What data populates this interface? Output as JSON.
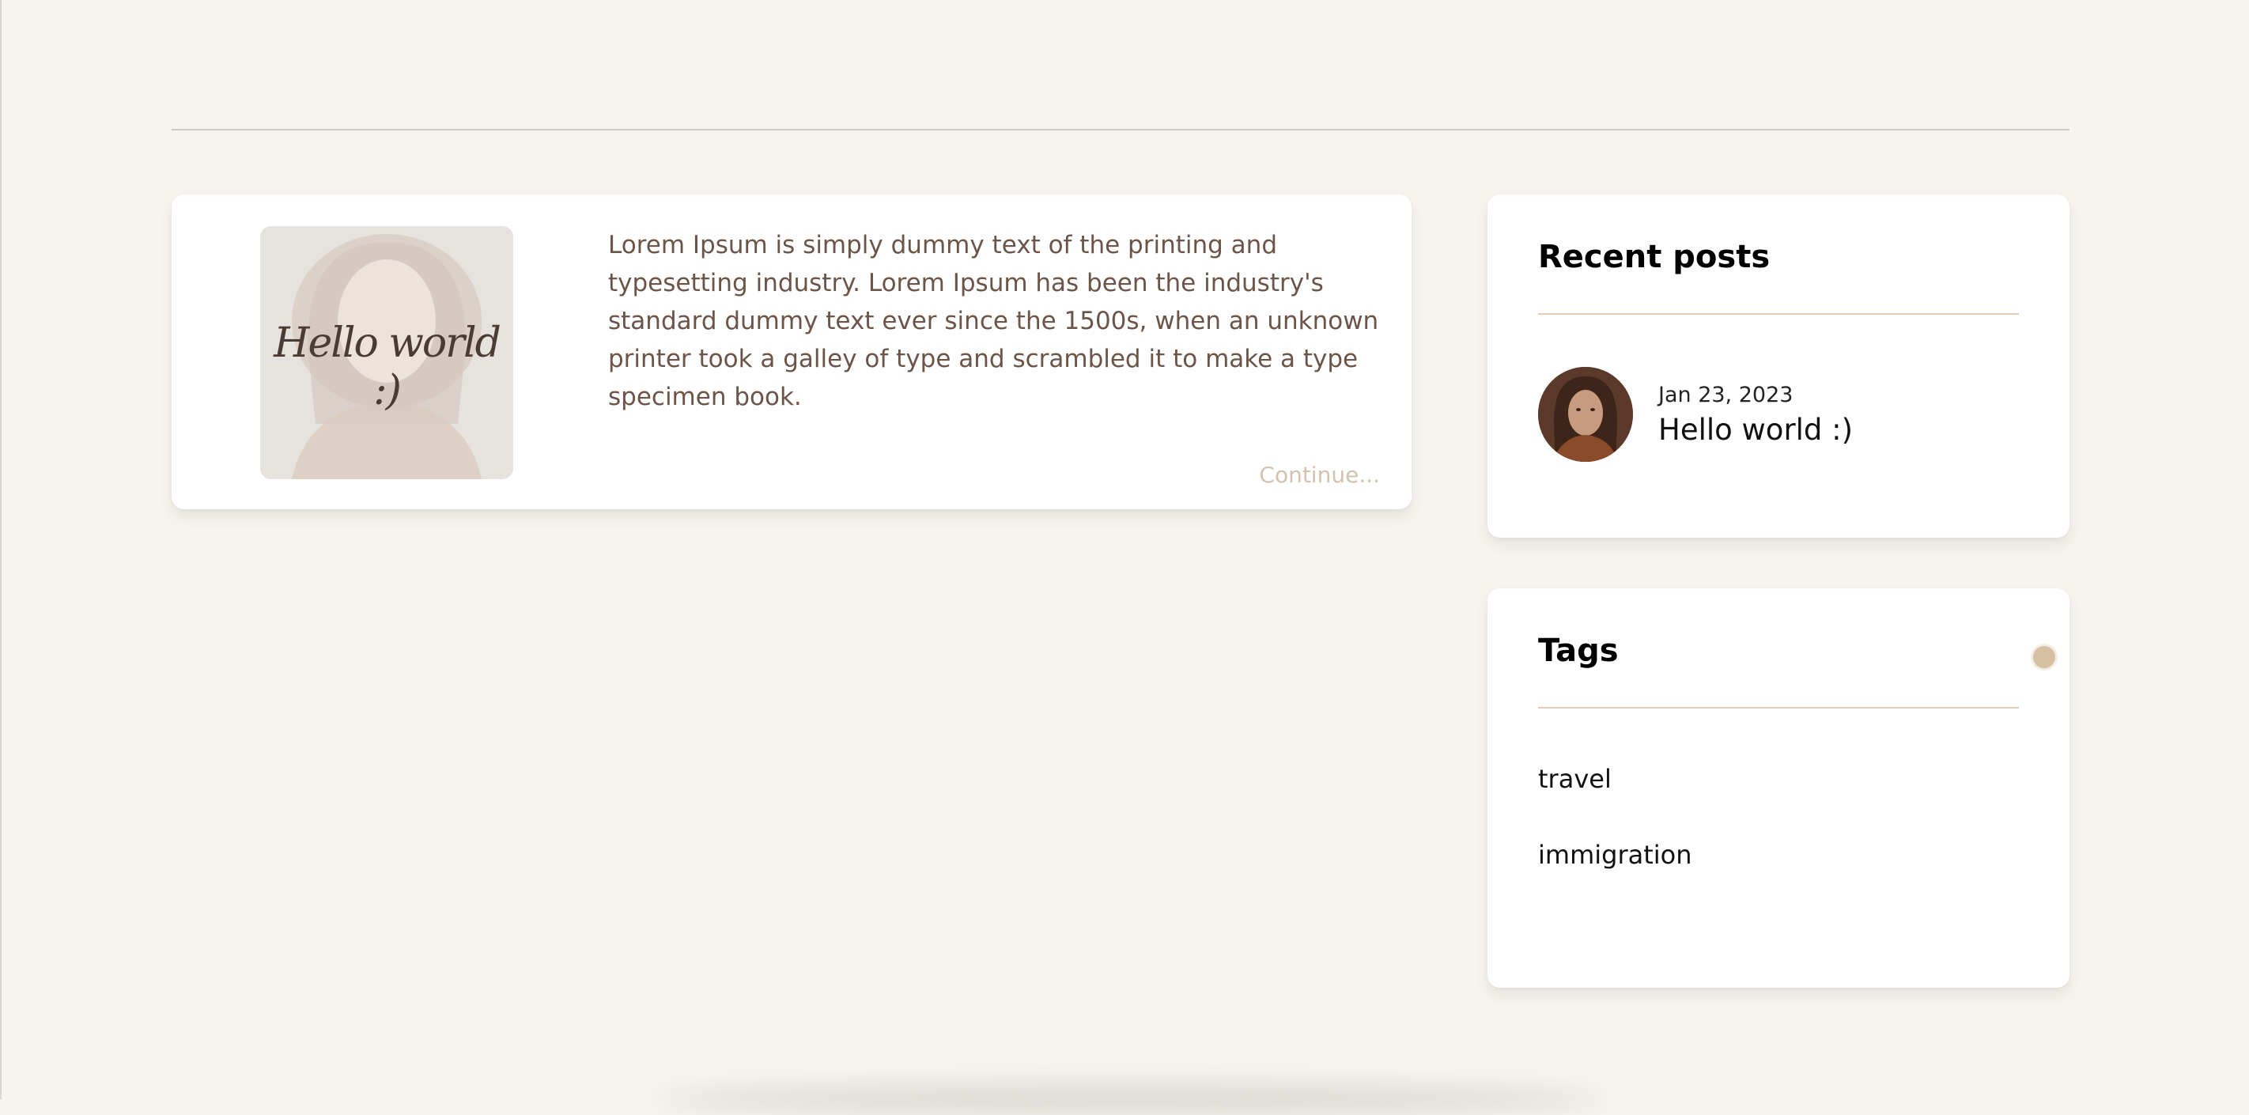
{
  "post": {
    "thumbnail_caption": "Hello world :)",
    "excerpt": "Lorem Ipsum is simply dummy text of the printing and typesetting industry. Lorem Ipsum has been the industry's standard dummy text ever since the 1500s, when an unknown printer took a galley of type and scrambled it to make a type specimen book.",
    "continue_label": "Continue..."
  },
  "recent_posts": {
    "title": "Recent posts",
    "items": [
      {
        "date": "Jan 23, 2023",
        "title": "Hello world :)"
      }
    ]
  },
  "tags": {
    "title": "Tags",
    "items": [
      {
        "label": "travel"
      },
      {
        "label": "immigration"
      }
    ]
  },
  "colors": {
    "background": "#f7f4ef",
    "card": "#ffffff",
    "excerpt_text": "#6b5448",
    "accent_muted": "#d4c2b0",
    "divider": "#ddcdb9"
  }
}
